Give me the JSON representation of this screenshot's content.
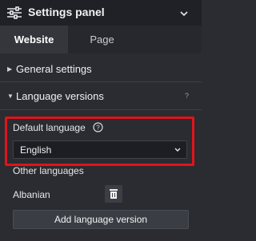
{
  "header": {
    "title": "Settings panel",
    "icon": "sliders-icon",
    "collapse_icon": "chevron-down-icon"
  },
  "tabs": [
    {
      "label": "Website",
      "active": true
    },
    {
      "label": "Page",
      "active": false
    }
  ],
  "sections": [
    {
      "label": "General settings",
      "expanded": false
    },
    {
      "label": "Language versions",
      "expanded": true,
      "help": "?"
    }
  ],
  "default_language": {
    "label": "Default language",
    "info_icon": "question-circle-icon",
    "selected": "English"
  },
  "other_languages": {
    "label": "Other languages",
    "items": [
      {
        "name": "Albanian"
      }
    ],
    "delete_icon": "trash-icon"
  },
  "add_button": {
    "label": "Add language version"
  },
  "colors": {
    "highlight": "#e0141b",
    "background": "#2a2c31",
    "header": "#1f2126"
  }
}
